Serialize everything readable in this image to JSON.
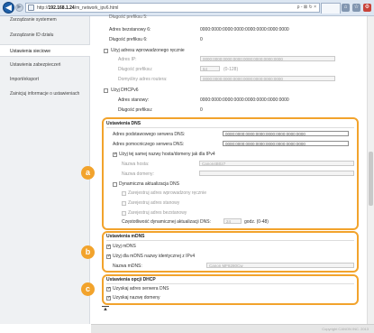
{
  "browser": {
    "url_prefix": "http://",
    "url_host": "192.168.1.24",
    "url_path": "/m_network_ipv6.html",
    "tools": "ρ - ⊠ ↻ ×"
  },
  "sidebar": {
    "items": [
      {
        "label": "Zarządzanie systemem"
      },
      {
        "label": "Zarządzanie ID działu"
      },
      {
        "label": "Ustawienia sieciowe"
      },
      {
        "label": "Ustawienia zabezpieczeń"
      },
      {
        "label": "Import/eksport"
      },
      {
        "label": "Zainicjuj informacje o ustawieniach"
      }
    ]
  },
  "ipv6_top": {
    "truncated_line": "Długość prefiksu 5:",
    "stateless_addr_label": "Adres bezstanowy 6:",
    "stateless_addr_value": "0000:0000:0000:0000:0000:0000:0000:0000",
    "prefix6_label": "Długość prefiksu 6:",
    "prefix6_value": "0",
    "manual_label": "Użyj adresu wprowadzonego ręcznie",
    "ip_label": "Adres IP:",
    "ip_value": "0000:0000:0000:0000:0000:0000:0000:0000",
    "prefix_label": "Długość prefiksu:",
    "prefix_value": "64",
    "prefix_range": "(0-128)",
    "router_label": "Domyślny adres routera:",
    "router_value": "0000:0000:0000:0000:0000:0000:0000:0000",
    "dhcp_label": "Użyj DHCPv6",
    "stateful_label": "Adres stanowy:",
    "stateful_value": "0000:0000:0000:0000:0000:0000:0000:0000",
    "stateful_prefix_label": "Długość prefiksu:",
    "stateful_prefix_value": "0"
  },
  "dns": {
    "title": "Ustawienia DNS",
    "primary_label": "Adres podstawowego serwera DNS:",
    "primary_value": "0000:0000:0000:0000:0000:0000:0000:0000",
    "secondary_label": "Adres pomocniczego serwera DNS:",
    "secondary_value": "0000:0000:0000:0000:0000:0000:0000:0000",
    "same_host_label": "Użyj tej samej nazwy hosta/domeny jak dla IPv4",
    "host_label": "Nazwa hosta:",
    "host_value": "Canon4B027",
    "domain_label": "Nazwa domeny:",
    "domain_value": "",
    "dynamic_label": "Dynamiczna aktualizacja DNS",
    "reg_manual_label": "Zarejestruj adres wprowadzony ręcznie",
    "reg_stateful_label": "Zarejestruj adres stanowy",
    "reg_stateless_label": "Zarejestruj adres bezstanowy",
    "interval_label": "Częstotliwość dynamicznej aktualizacji DNS:",
    "interval_value": "24",
    "interval_unit": "godz. (0-48)",
    "badge": "a"
  },
  "mdns": {
    "title": "Ustawienia mDNS",
    "use_label": "Użyj mDNS",
    "same_name_label": "Użyj dla mDNS nazwy identycznej z IPv4",
    "name_label": "Nazwa mDNS:",
    "name_value": "Canon MF8280Cw",
    "badge": "b"
  },
  "dhcp_opts": {
    "title": "Ustawienia opcji DHCP",
    "server_label": "Uzyskaj adres serwera DNS",
    "domain_label": "Uzyskaj nazwę domeny",
    "badge": "c"
  },
  "footer": {
    "top_arrow": "▲",
    "copyright": "Copyright CANON INC. 2013"
  },
  "colors": {
    "highlight": "#f2a32c",
    "nav_back": "#1e5fa8"
  }
}
